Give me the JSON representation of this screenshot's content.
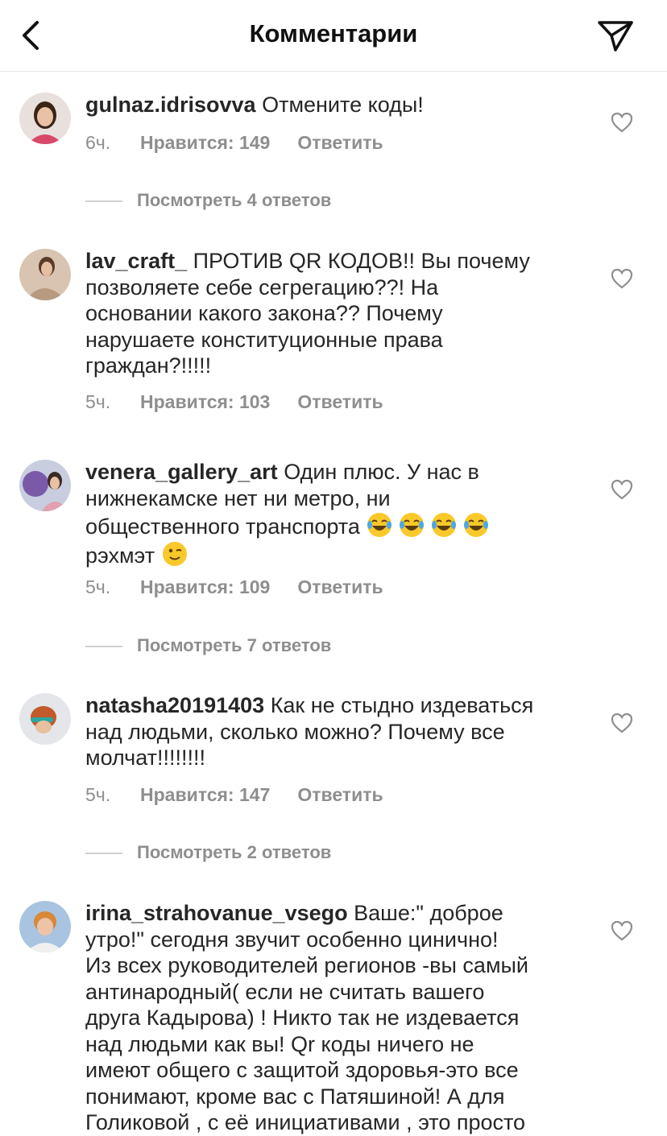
{
  "header": {
    "title": "Комментарии",
    "back_icon": "chevron-left-icon",
    "share_icon": "paper-plane-icon"
  },
  "comments": [
    {
      "username": "gulnaz.idrisovva",
      "text_lines": [
        "Отмените коды!"
      ],
      "time": "6ч.",
      "likes": "Нравится: 149",
      "reply": "Ответить",
      "view_replies": "Посмотреть 4 ответов"
    },
    {
      "username": "lav_craft_",
      "text_lines": [
        "ПРОТИВ QR КОДОВ!! Вы почему",
        "позволяете себе сегрегацию??! На",
        "основании какого закона?? Почему",
        "нарушаете конституционные права",
        "граждан?!!!!!"
      ],
      "time": "5ч.",
      "likes": "Нравится: 103",
      "reply": "Ответить"
    },
    {
      "username": "venera_gallery_art",
      "text_lines": [
        "Один плюс. У нас в",
        "нижнекамске нет ни метро, ни",
        "общественного транспорта",
        "рэхмэт"
      ],
      "emoji_line3": [
        "face-with-tears-of-joy",
        "face-with-tears-of-joy",
        "face-with-tears-of-joy",
        "face-with-tears-of-joy"
      ],
      "emoji_line4": [
        "winking-face"
      ],
      "time": "5ч.",
      "likes": "Нравится: 109",
      "reply": "Ответить",
      "view_replies": "Посмотреть 7 ответов"
    },
    {
      "username": "natasha20191403",
      "text_lines": [
        "Как не стыдно издеваться",
        "над людьми, сколько можно? Почему все",
        "молчат!!!!!!!!"
      ],
      "time": "5ч.",
      "likes": "Нравится: 147",
      "reply": "Ответить",
      "view_replies": "Посмотреть 2 ответов"
    },
    {
      "username": "irina_strahovanue_vsego",
      "text_lines": [
        "Ваше:\" доброе",
        "утро!\" сегодня звучит особенно  цинично!",
        "Из всех руководителей регионов -вы самый",
        "антинародный( если не считать вашего",
        "друга Кадырова) ! Никто  так не издевается",
        "над людьми как вы! Qr коды ничего не",
        "имеют общего с защитой здоровья-это все",
        "понимают, кроме вас с Патяшиной! А для",
        "Голиковой , с её инициативами , это просто"
      ]
    }
  ],
  "colors": {
    "text": "#262626",
    "meta": "#8e8e8e",
    "divider": "#e6e6e6"
  }
}
